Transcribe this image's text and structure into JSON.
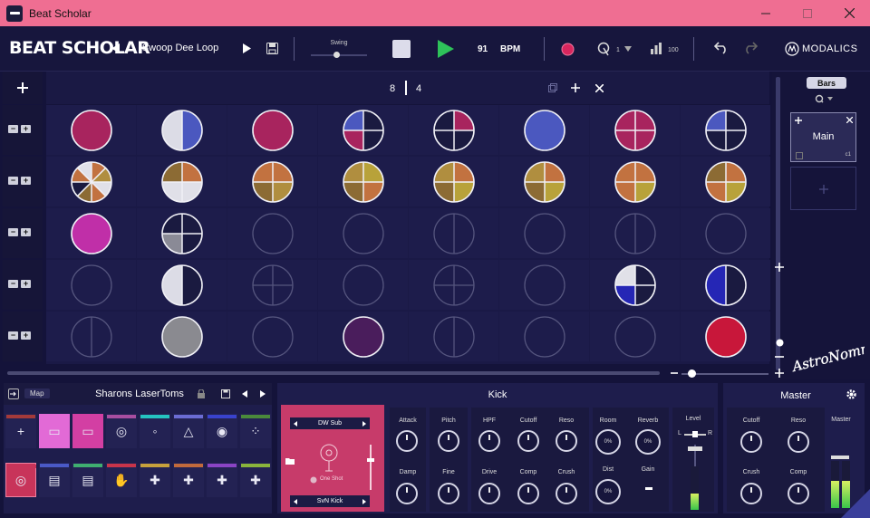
{
  "window": {
    "title": "Beat Scholar"
  },
  "toolbar": {
    "logo": "BEAT SCHOLAR",
    "loop_name": "Swoop Dee Loop",
    "swing_label": "Swing",
    "swing_value": 0.45,
    "bpm_value": "91",
    "bpm_unit": "BPM",
    "metronome_value": "1",
    "velocity_value": "100",
    "brand": "MODALICS"
  },
  "grid": {
    "time_signature": {
      "top": "8",
      "bottom": "4"
    },
    "rows": [
      [
        [
          "#a8245e"
        ],
        [
          "#4b58bf",
          "#dcdce6"
        ],
        [
          "#a8245e"
        ],
        [
          "#1a1a40",
          "#1a1a40",
          "#a8245e",
          "#4b58bf"
        ],
        [
          "#a8245e",
          "#1a1a40",
          "#1a1a40",
          "#1a1a40"
        ],
        [
          "#4b58bf"
        ],
        [
          "#a8245e",
          "#a8245e",
          "#a8245e",
          "#a8245e"
        ],
        [
          "#1a1a40",
          "#1a1a40",
          "#1a1a40",
          "#4b58bf"
        ]
      ],
      [
        [
          "#c27240",
          "#b08e3f",
          "#e0e0e8",
          "#c27240",
          "#8c6b34",
          "#1a1a40",
          "#c27240",
          "#e0e0e8"
        ],
        [
          "#c27240",
          "#e0e0e8",
          "#e0e0e8",
          "#8c6b34"
        ],
        [
          "#c27240",
          "#b08e3f",
          "#8c6b34",
          "#c27240"
        ],
        [
          "#b8a23a",
          "#c27240",
          "#8c6b34",
          "#b08e3f"
        ],
        [
          "#c27240",
          "#b8a23a",
          "#8c6b34",
          "#b08e3f"
        ],
        [
          "#c27240",
          "#b8a23a",
          "#8c6b34",
          "#b08e3f"
        ],
        [
          "#c27240",
          "#b8a23a",
          "#c27240",
          "#c27240"
        ],
        [
          "#c27240",
          "#b8a23a",
          "#c27240",
          "#8c6b34"
        ]
      ],
      [
        [
          "#c02fa8"
        ],
        [
          "#1a1a40",
          "#1a1a40",
          "#8a8a96",
          "#1a1a40"
        ],
        [],
        [],
        [
          "|"
        ],
        [],
        [
          "|"
        ],
        []
      ],
      [
        [],
        [
          "#1a1a40",
          "#dcdce6"
        ],
        [
          "+"
        ],
        [],
        [
          "+"
        ],
        [],
        [
          "#1a1a40",
          "#1a1a40",
          "#2526b5",
          "#e0e0e8"
        ],
        [
          "#1a1a40",
          "#2526b5"
        ]
      ],
      [
        [
          "|"
        ],
        [
          "#8a8a90"
        ],
        [],
        [
          "#4a1d5c"
        ],
        [
          "|"
        ],
        [],
        [],
        [
          "#c8173a"
        ]
      ]
    ]
  },
  "patterns": {
    "bars_label": "Bars",
    "main_name": "Main",
    "main_sub": "c1"
  },
  "signature": "AstroNommy",
  "kit_panel": {
    "map_label": "Map",
    "kit_name": "Sharons LaserToms",
    "pad_colors": [
      "#a43a3a",
      "#e26ad6",
      "#d33fa3",
      "#a84ea0",
      "#25c3c0",
      "#6b6cd3",
      "#3942cd",
      "#4a8a3b",
      "#c8345a",
      "#4a59c6",
      "#3fae70",
      "#c8344a",
      "#c7a13c",
      "#c16a3c",
      "#8a44c4",
      "#8ab43c"
    ]
  },
  "instrument": {
    "name": "Kick",
    "sample_top": "DW Sub",
    "sample_bottom": "SvN Kick",
    "one_shot": "One Shot",
    "knobs": {
      "attack": "Attack",
      "damp": "Damp",
      "pitch": "Pitch",
      "fine": "Fine",
      "hpf": "HPF",
      "cutoff": "Cutoff",
      "reso": "Reso",
      "drive": "Drive",
      "comp": "Comp",
      "crush": "Crush",
      "room": "Room",
      "reverb": "Reverb",
      "dist": "Dist",
      "gain": "Gain",
      "level": "Level",
      "left": "L",
      "right": "R"
    },
    "room_value": "0%",
    "reverb_value": "0%",
    "dist_value": "0%"
  },
  "master": {
    "title": "Master",
    "knobs": {
      "cutoff": "Cutoff",
      "reso": "Reso",
      "crush": "Crush",
      "comp": "Comp"
    },
    "meter_label": "Master"
  }
}
